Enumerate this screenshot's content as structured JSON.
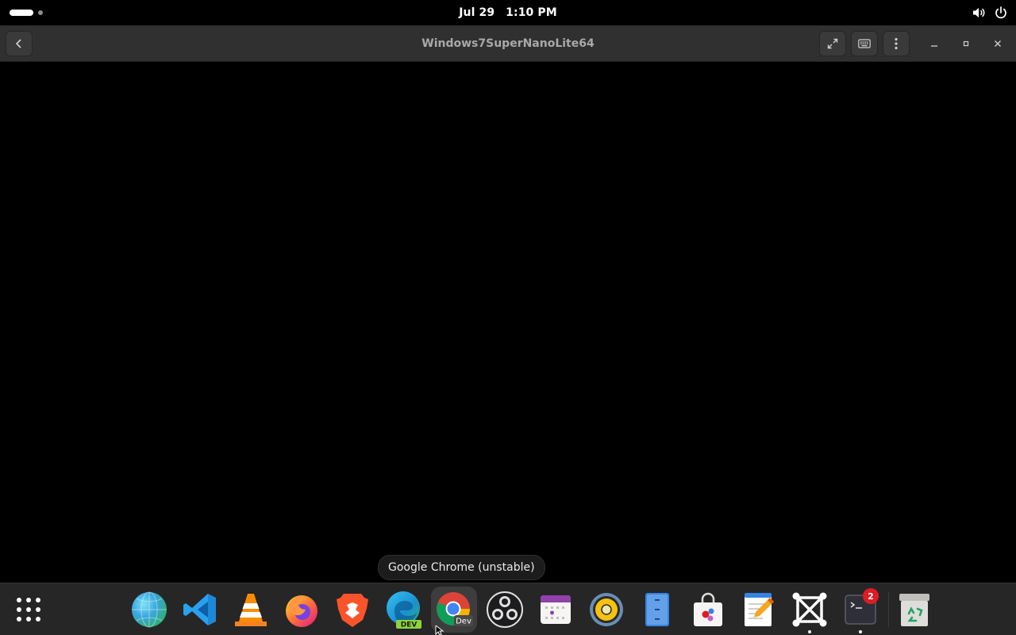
{
  "topbar": {
    "date": "Jul 29",
    "time": "1:10 PM",
    "tray_icons": [
      "volume-icon",
      "power-icon"
    ]
  },
  "window": {
    "title": "Windows7SuperNanoLite64",
    "buttons": [
      "back-icon",
      "fullscreen-icon",
      "keyboard-icon",
      "menu-icon",
      "minimize-icon",
      "maximize-icon",
      "close-icon"
    ]
  },
  "tooltip": {
    "text": "Google Chrome (unstable)"
  },
  "dock": {
    "items": [
      {
        "name": "show-apps",
        "label": ""
      },
      {
        "name": "web-browser-globe",
        "label": ""
      },
      {
        "name": "visual-studio-code",
        "label": ""
      },
      {
        "name": "vlc-media-player",
        "label": ""
      },
      {
        "name": "firefox",
        "label": ""
      },
      {
        "name": "brave-browser",
        "label": ""
      },
      {
        "name": "microsoft-edge-dev",
        "label": "DEV"
      },
      {
        "name": "google-chrome-unstable",
        "label": "Dev"
      },
      {
        "name": "obs-studio",
        "label": ""
      },
      {
        "name": "calendar",
        "label": ""
      },
      {
        "name": "rhythmbox",
        "label": ""
      },
      {
        "name": "file-cabinet",
        "label": ""
      },
      {
        "name": "software-store",
        "label": ""
      },
      {
        "name": "text-editor",
        "label": ""
      },
      {
        "name": "boxes",
        "label": ""
      },
      {
        "name": "terminal",
        "label": ""
      },
      {
        "name": "trash",
        "label": ""
      }
    ],
    "terminal_badge": "2"
  },
  "colors": {
    "topbar": "#000000",
    "headerbar": "#303030",
    "dock": "#262626",
    "badge": "#e01b24",
    "title_text": "#a9a9a9"
  }
}
